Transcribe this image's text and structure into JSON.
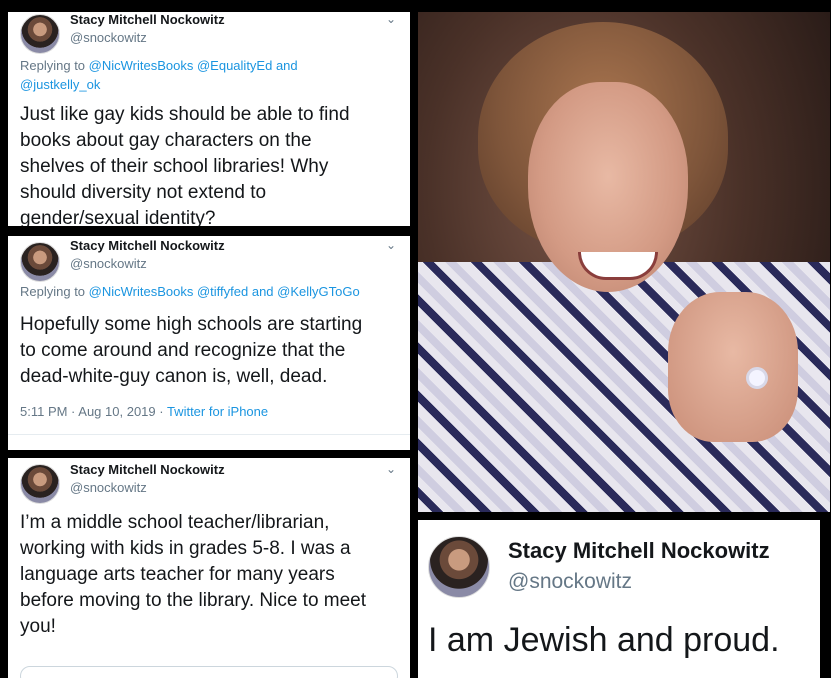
{
  "tweets": [
    {
      "name": "Stacy Mitchell Nockowitz",
      "handle": "@snockowitz",
      "replying_prefix": "Replying to",
      "mentions_line1": "@NicWritesBooks @EqualityEd and",
      "mentions_line2": "@justkelly_ok",
      "body_lines": [
        "Just like gay kids should be able to find",
        "books about gay characters on the",
        "shelves of their school libraries! Why",
        "should diversity not extend to",
        "gender/sexual identity?"
      ]
    },
    {
      "name": "Stacy Mitchell Nockowitz",
      "handle": "@snockowitz",
      "replying_prefix": "Replying to",
      "mentions": "@NicWritesBooks @tiffyfed and @KellyGToGo",
      "body_lines": [
        "Hopefully some high schools are starting",
        "to come around and recognize that the",
        "dead-white-guy canon is, well, dead."
      ],
      "timestamp": "5:11 PM · Aug 10, 2019 · ",
      "source": "Twitter for iPhone"
    },
    {
      "name": "Stacy Mitchell Nockowitz",
      "handle": "@snockowitz",
      "body_lines": [
        "I’m a middle school teacher/librarian,",
        "working with kids in grades 5-8. I was a",
        "language arts teacher for many years",
        "before moving to the library. Nice to meet",
        "you!"
      ]
    }
  ],
  "profile_card": {
    "name": "Stacy Mitchell Nockowitz",
    "handle": "@snockowitz",
    "body": "I am Jewish and proud."
  },
  "icons": {
    "chevron": "chevron-down-icon",
    "avatar": "avatar"
  },
  "colors": {
    "link_blue": "#1b95e0",
    "text_gray": "#657786",
    "text_dark": "#14171a"
  }
}
